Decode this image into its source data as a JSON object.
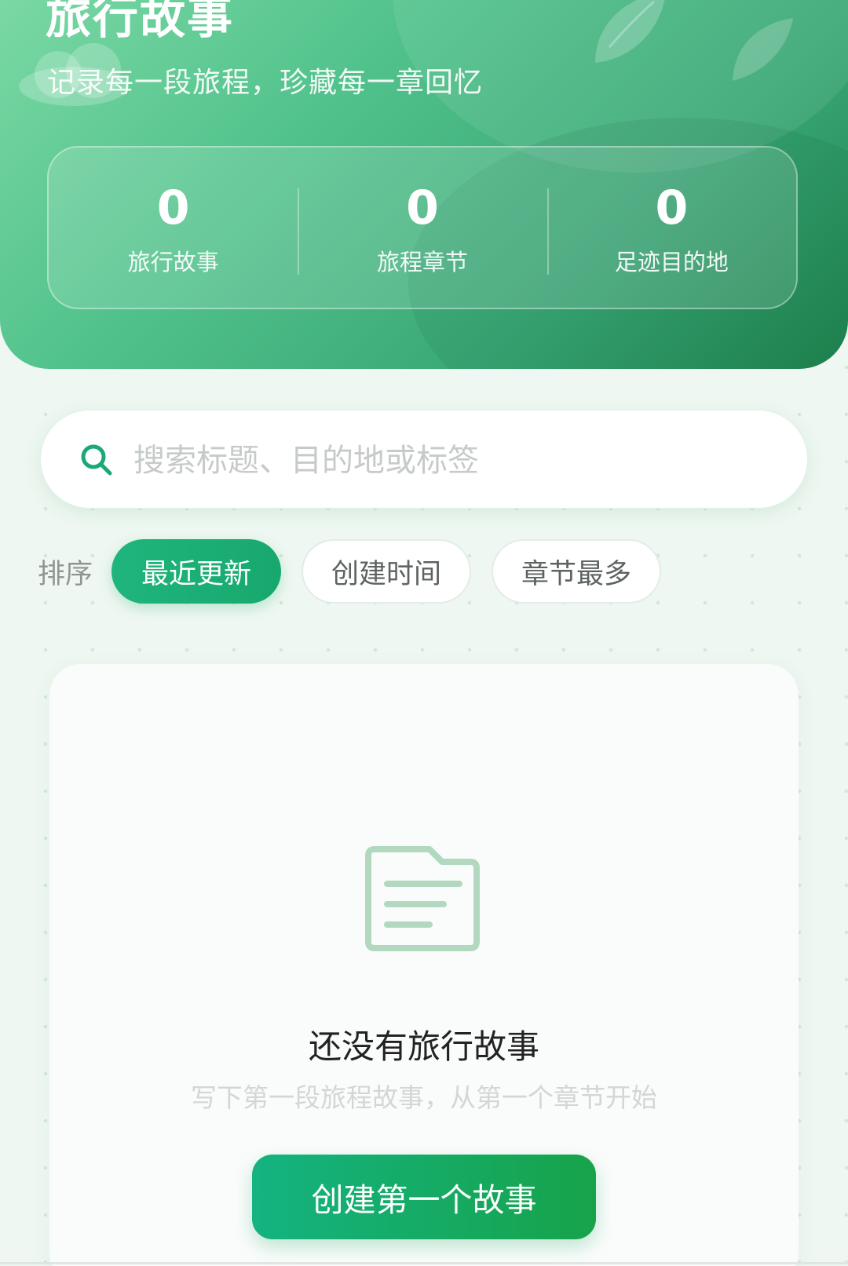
{
  "header": {
    "title": "旅行故事",
    "subtitle": "记录每一段旅程，珍藏每一章回忆"
  },
  "stats": [
    {
      "value": "0",
      "label": "旅行故事"
    },
    {
      "value": "0",
      "label": "旅程章节"
    },
    {
      "value": "0",
      "label": "足迹目的地"
    }
  ],
  "search": {
    "placeholder": "搜索标题、目的地或标签",
    "value": ""
  },
  "sort": {
    "label": "排序",
    "options": [
      {
        "label": "最近更新",
        "active": true
      },
      {
        "label": "创建时间",
        "active": false
      },
      {
        "label": "章节最多",
        "active": false
      }
    ]
  },
  "empty_state": {
    "icon": "document-folder-icon",
    "title": "还没有旅行故事",
    "description": "写下第一段旅程故事，从第一个章节开始",
    "button_label": "创建第一个故事"
  },
  "colors": {
    "accent": "#1fb57c",
    "header_start": "#7ad8a4",
    "header_end": "#1f8550",
    "icon_muted": "#b2d8c0"
  }
}
